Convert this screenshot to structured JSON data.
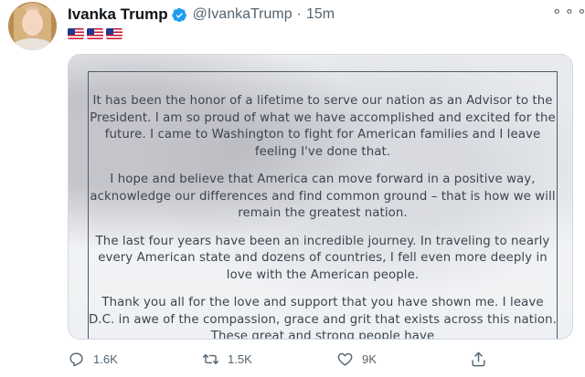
{
  "author": {
    "name": "Ivanka Trump",
    "handle": "@IvankaTrump",
    "separator": "·",
    "time": "15m",
    "verified": true,
    "bio_flags": [
      "us-flag",
      "us-flag",
      "us-flag"
    ]
  },
  "menu": {
    "icon": "more-horizontal-icon"
  },
  "letter": {
    "paragraphs": [
      "It has been the honor of a lifetime to serve our nation as an Advisor to the President. I am so proud of what we have accomplished and excited for the future. I came to Washington to fight for American families and I leave feeling I've done that.",
      "I hope and believe that America can move forward in a positive way, acknowledge our differences and find common ground – that is how we will remain the greatest nation.",
      "The last four years have been an incredible journey. In traveling to nearly every American state and dozens of countries, I fell even more deeply in love with the American people.",
      "Thank you all for the love and support that you have shown me. I leave D.C. in awe of the compassion, grace and grit that exists across this nation. These great and strong people have"
    ]
  },
  "actions": {
    "reply_count": "1.6K",
    "retweet_count": "1.5K",
    "like_count": "9K"
  },
  "colors": {
    "text_primary": "#0f1419",
    "text_secondary": "#536471",
    "verified_blue": "#1d9bf0",
    "letter_text": "#3d4350"
  }
}
